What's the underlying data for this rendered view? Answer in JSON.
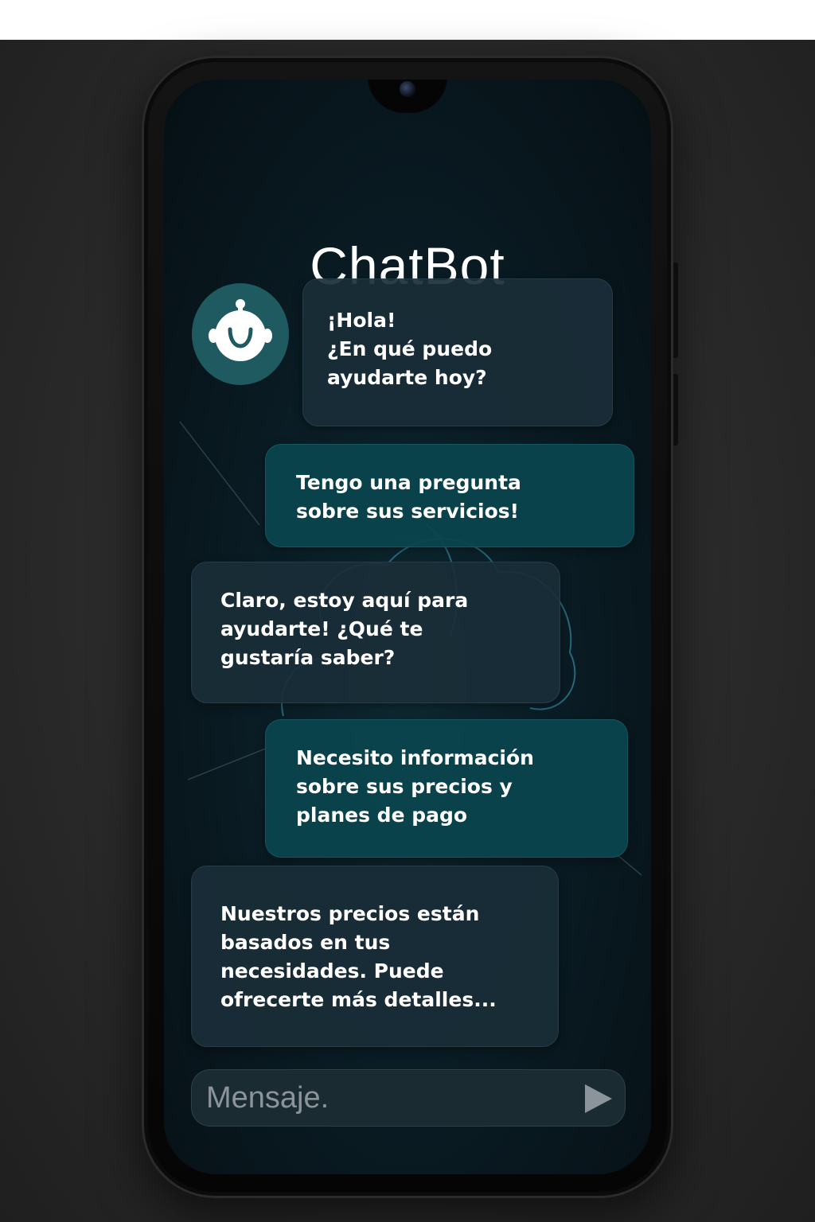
{
  "app": {
    "title": "ChatBot"
  },
  "messages": [
    {
      "sender": "bot",
      "text": "¡Hola!\n¿En qué puedo\nayudarte hoy?"
    },
    {
      "sender": "user",
      "text": "Tengo una pregunta\nsobre sus servicios!"
    },
    {
      "sender": "bot",
      "text": "Claro, estoy aquí para\nayudarte! ¿Qué te\ngustaría saber?"
    },
    {
      "sender": "user",
      "text": "Necesito información\nsobre sus precios y\nplanes de pago"
    },
    {
      "sender": "bot",
      "text": "Nuestros precios están\nbasados en tus\nnecesidades. Puede\nofrecerte más detalles..."
    }
  ],
  "composer": {
    "placeholder": "Mensaje."
  },
  "icons": {
    "avatar": "robot-face-icon",
    "send": "send-icon"
  },
  "colors": {
    "accent": "#1e5a60",
    "user_bubble": "#0b454e",
    "bot_bubble": "#1a2e38"
  }
}
